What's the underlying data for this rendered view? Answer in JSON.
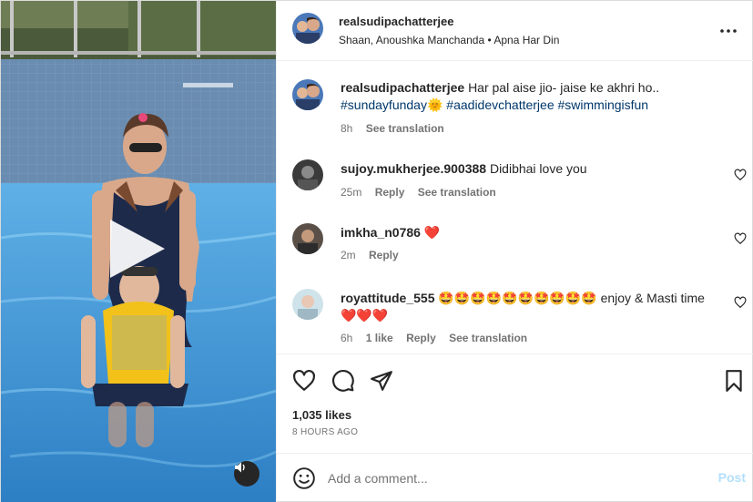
{
  "header": {
    "username": "realsudipachatterjee",
    "audio": "Shaan, Anoushka Manchanda",
    "separator": "•",
    "track": "Apna Har Din",
    "more_icon": "more-horizontal-icon"
  },
  "caption": {
    "username": "realsudipachatterjee",
    "text": "Har pal aise jio- jaise ke akhri ho..",
    "tag1": "#sundayfunday",
    "emoji": "🌞",
    "tag2": "#aadidevchatterjee",
    "tag3": "#swimmingisfun",
    "time": "8h",
    "translate": "See translation"
  },
  "comments": [
    {
      "username": "sujoy.mukherjee.900388",
      "text": "Didibhai love you",
      "time": "25m",
      "reply": "Reply",
      "translate": "See translation"
    },
    {
      "username": "imkha_n0786",
      "text": "❤️",
      "time": "2m",
      "reply": "Reply"
    },
    {
      "username": "royattitude_555",
      "text": "🤩🤩🤩🤩🤩🤩🤩🤩🤩🤩 enjoy & Masti time ❤️❤️❤️",
      "time": "6h",
      "likes": "1 like",
      "reply": "Reply",
      "translate": "See translation"
    }
  ],
  "stats": {
    "likes": "1,035 likes",
    "time": "8 HOURS AGO"
  },
  "composer": {
    "placeholder": "Add a comment...",
    "post": "Post"
  },
  "colors": {
    "link": "#00376b",
    "muted": "#737373",
    "post_disabled": "#b2dffc",
    "heart_red": "#e0245e",
    "pool": "#3f88c8"
  }
}
